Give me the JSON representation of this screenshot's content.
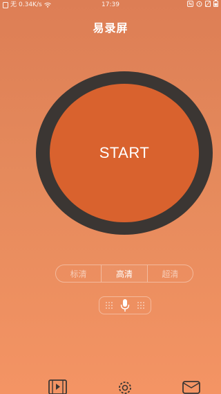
{
  "status_bar": {
    "carrier": "无",
    "net_speed": "0.34K/s",
    "time": "17:39",
    "icons": [
      "sim-icon",
      "wifi-icon",
      "nfc-icon",
      "alarm-icon",
      "no-sim-icon",
      "battery-icon"
    ]
  },
  "header": {
    "title": "易录屏"
  },
  "main": {
    "start_label": "START"
  },
  "quality": {
    "options": [
      "标清",
      "高清",
      "超清"
    ],
    "selected": "高清"
  },
  "audio": {
    "icon": "microphone-icon"
  },
  "bottom_nav": {
    "items": [
      "video-list-icon",
      "settings-icon",
      "mail-icon"
    ]
  },
  "colors": {
    "background_top": "#dd7e55",
    "background_bottom": "#f49464",
    "ring": "#3b3633",
    "button": "#d9622e",
    "text": "#ffffff"
  }
}
